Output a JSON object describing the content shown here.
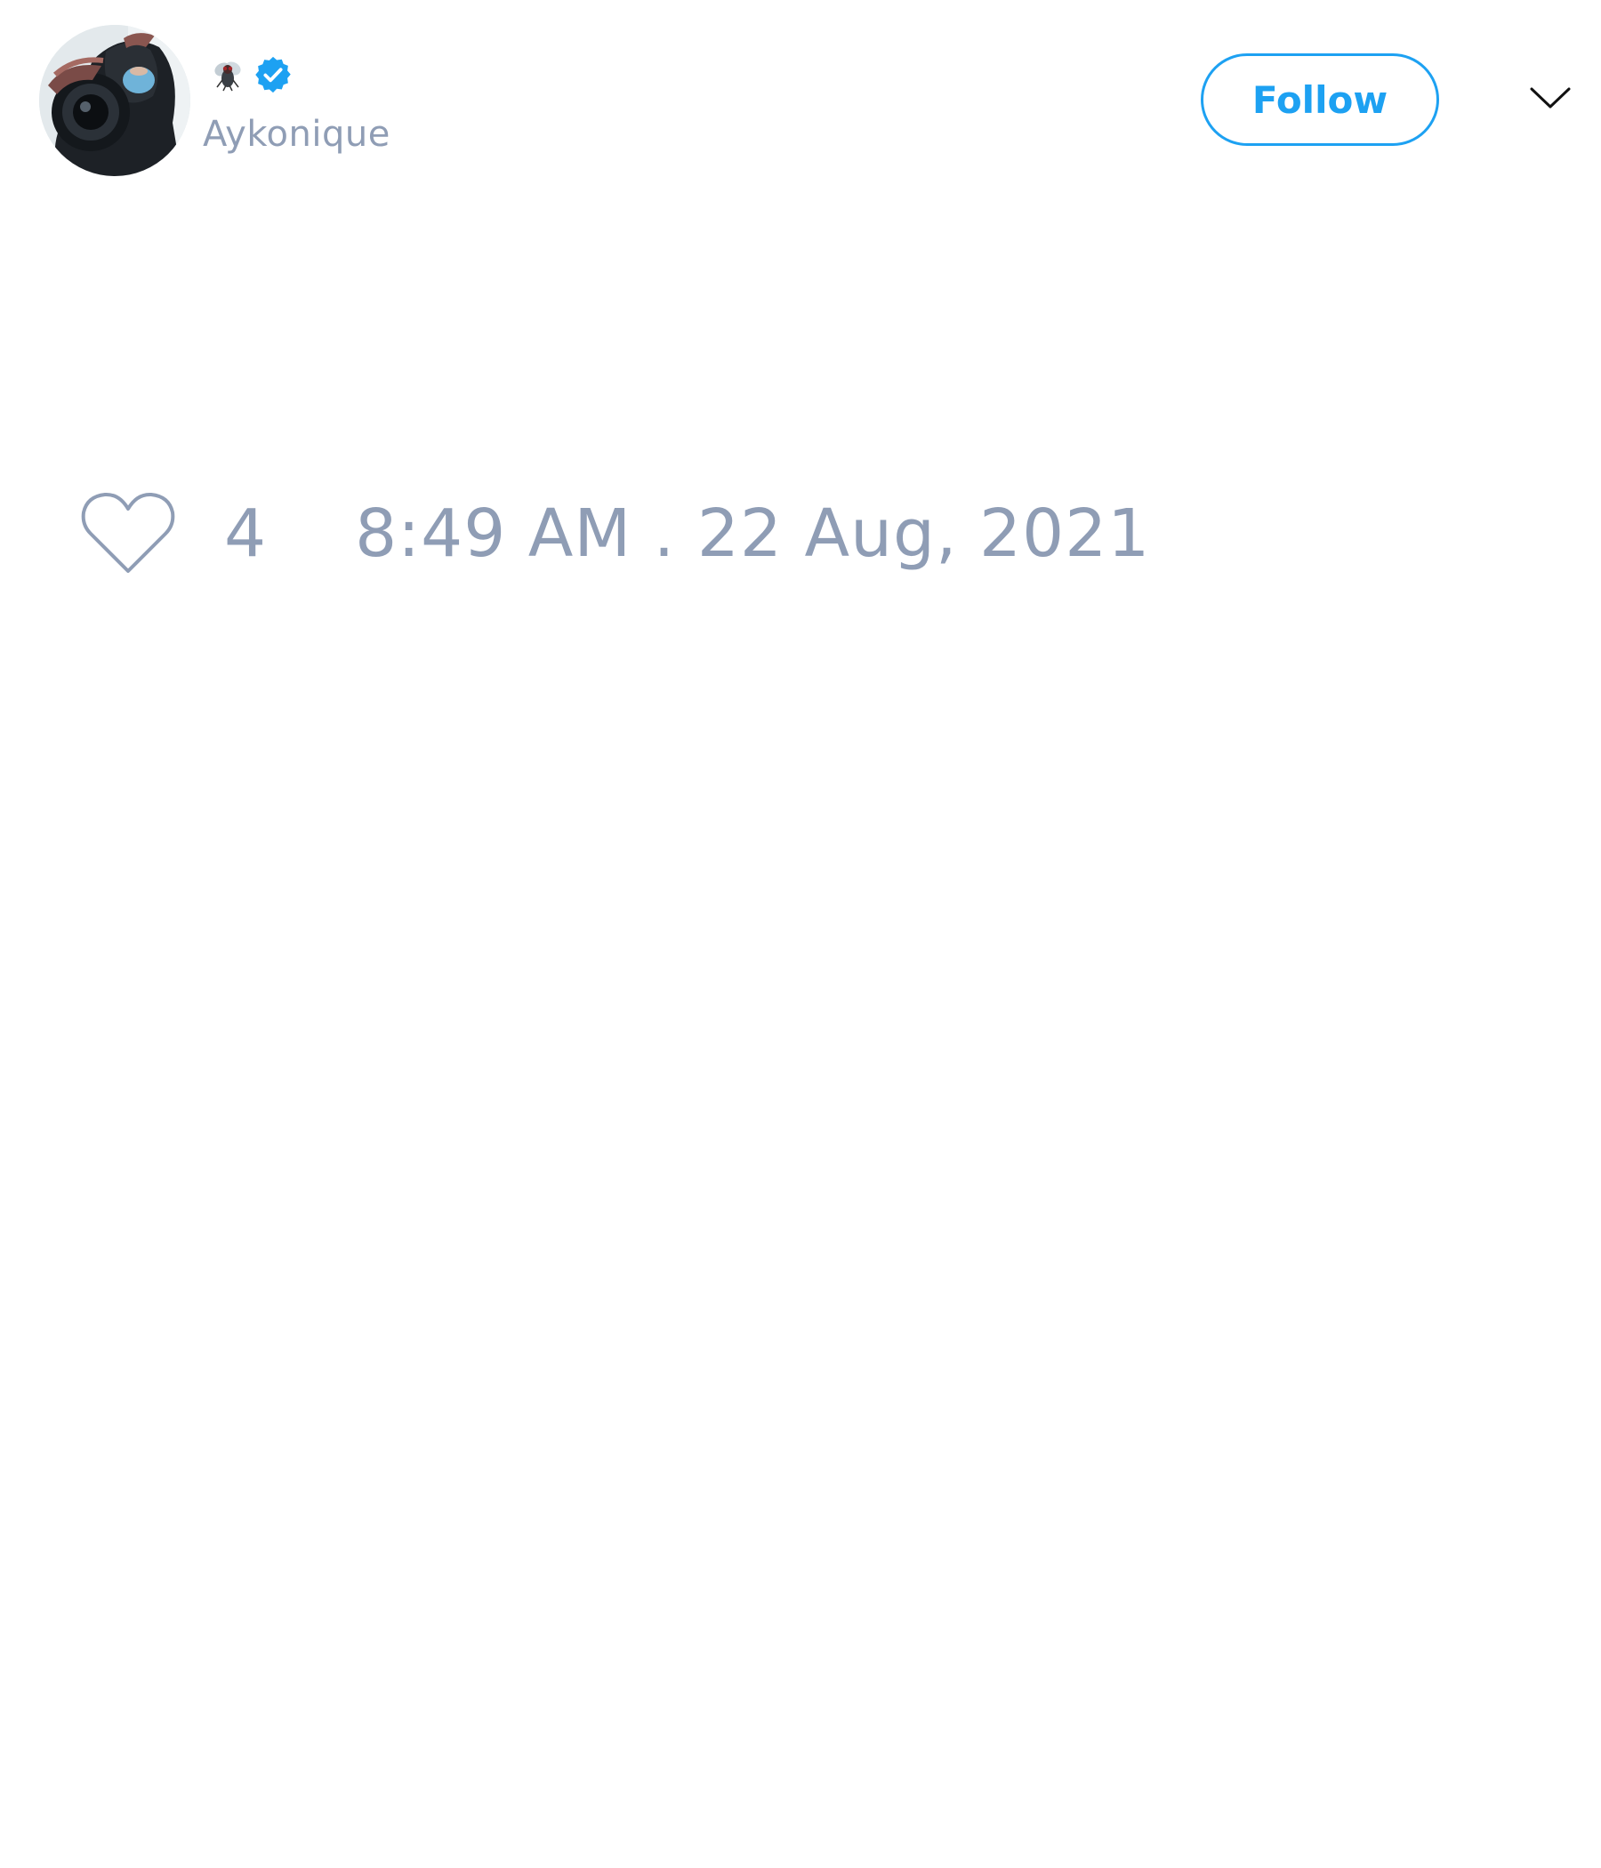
{
  "tweet": {
    "author": {
      "display_name_icon": "fly-emoji",
      "verified_icon": "verified-badge-icon",
      "username": "Aykonique"
    },
    "follow_label": "Follow",
    "menu_icon": "chevron-down-icon",
    "like_icon": "heart-outline-icon",
    "like_count": "4",
    "timestamp": "8:49 AM . 22 Aug, 2021"
  },
  "colors": {
    "accent": "#1da1f2",
    "muted_text": "#8f9db5",
    "background": "#ffffff"
  }
}
